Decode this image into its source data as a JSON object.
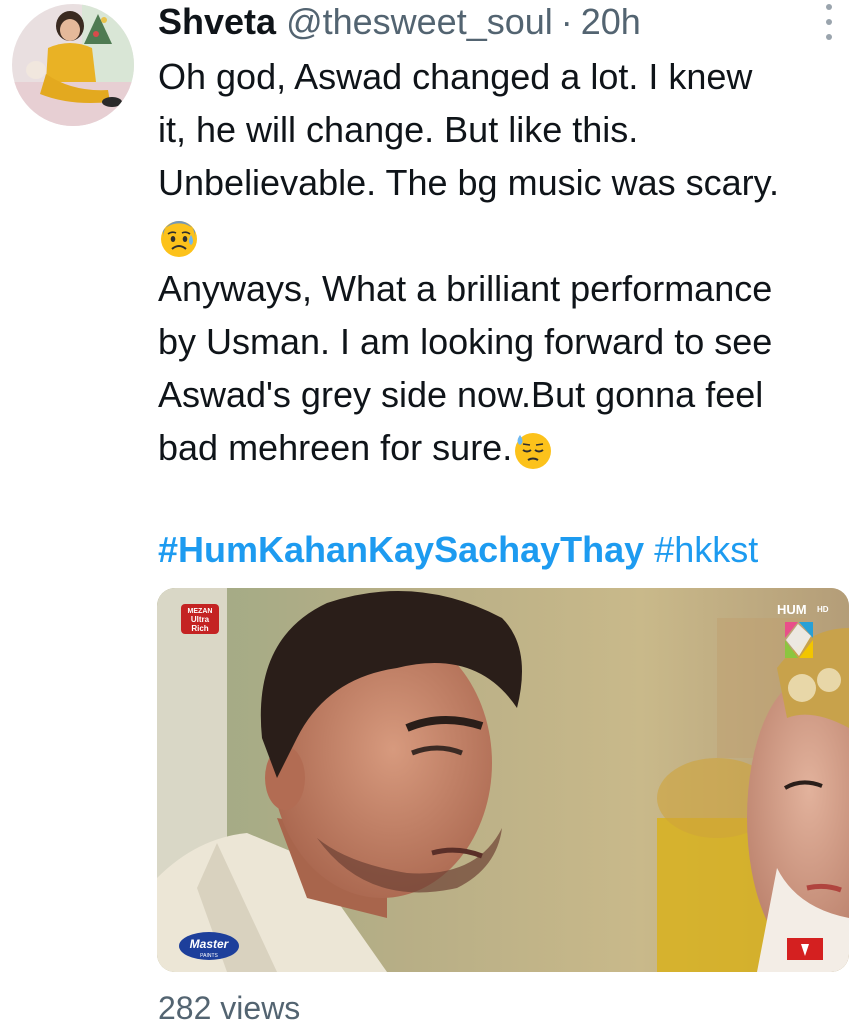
{
  "tweet": {
    "display_name": "Shveta",
    "handle": "@thesweet_soul",
    "separator": "·",
    "time": "20h",
    "lines": [
      "Oh god, Aswad changed a lot. I knew",
      "it, he will change. But like this.",
      "Unbelievable. The bg music was scary.",
      "Anyways, What a brilliant performance",
      "by Usman. I am looking forward to see",
      "Aswad's grey side now.But gonna feel",
      "bad mehreen for sure."
    ],
    "emojis": [
      "anxious-face-with-sweat-icon",
      "downcast-face-with-sweat-icon"
    ],
    "hashtags": [
      "#HumKahanKaySachayThay",
      "#hkkst"
    ],
    "views": "282 views"
  },
  "media": {
    "description_icon": "video-still",
    "overlay": {
      "sponsor_top_left": [
        "MEZAN",
        "Ultra",
        "Rich"
      ],
      "channel_logo": [
        "HUM",
        "HD"
      ],
      "sponsor_bottom_left": [
        "Master",
        "PAINTS"
      ]
    }
  },
  "colors": {
    "link": "#1d9bf0",
    "secondary_text": "#536471",
    "primary_text": "#0f1419"
  }
}
